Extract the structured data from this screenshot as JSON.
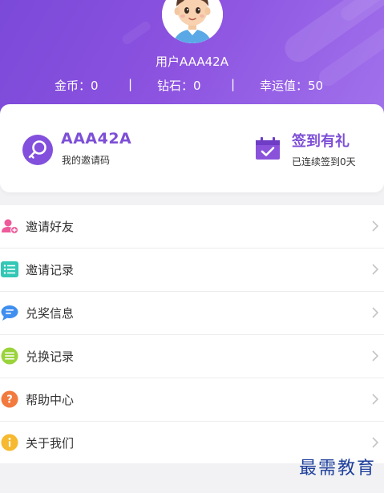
{
  "colors": {
    "accent": "#7d4fd6",
    "header_start": "#7b49d8",
    "header_end": "#a172ec"
  },
  "profile": {
    "username": "用户AAA42A",
    "avatar_icon": "avatar-boy"
  },
  "stats": {
    "coins": "金币：0",
    "diamonds": "钻石：0",
    "luck": "幸运值：50",
    "separator": "|"
  },
  "invite": {
    "code": "AAA42A",
    "label": "我的邀请码",
    "icon": "key-icon"
  },
  "checkin": {
    "title": "签到有礼",
    "subtitle": "已连续签到0天",
    "icon": "calendar-check-icon"
  },
  "menu": {
    "items": [
      {
        "label": "邀请好友",
        "icon": "add-user-icon",
        "color": "#ee5a9a"
      },
      {
        "label": "邀请记录",
        "icon": "list-icon",
        "color": "#33c7b6"
      },
      {
        "label": "兑奖信息",
        "icon": "chat-bubble-icon",
        "color": "#3f8ff0"
      },
      {
        "label": "兑换记录",
        "icon": "list-circle-icon",
        "color": "#9ad33a"
      },
      {
        "label": "帮助中心",
        "icon": "help-icon",
        "color": "#f27a3e"
      },
      {
        "label": "关于我们",
        "icon": "info-icon",
        "color": "#f6b92f"
      }
    ]
  },
  "watermark": "最需教育"
}
